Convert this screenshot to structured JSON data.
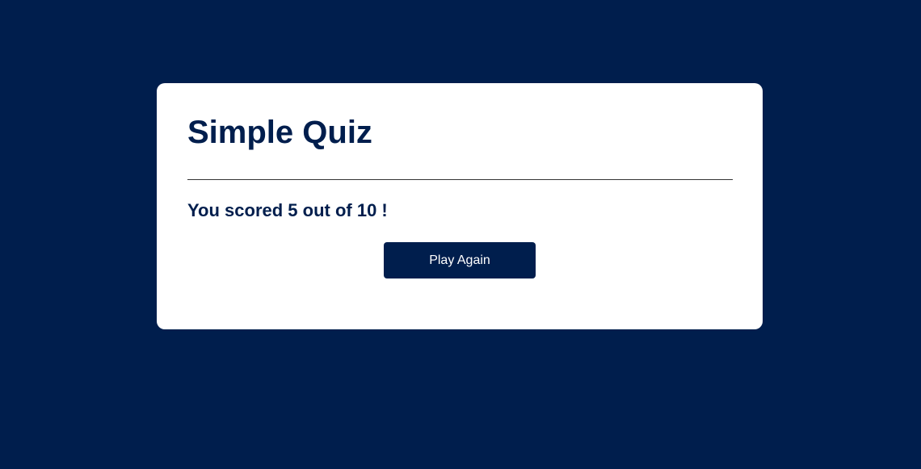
{
  "quiz": {
    "title": "Simple Quiz",
    "result_text": "You scored 5 out of 10 !",
    "play_again_label": "Play Again"
  },
  "colors": {
    "background": "#001e4d",
    "card": "#ffffff",
    "accent": "#001e4d",
    "button_text": "#ffffff"
  }
}
